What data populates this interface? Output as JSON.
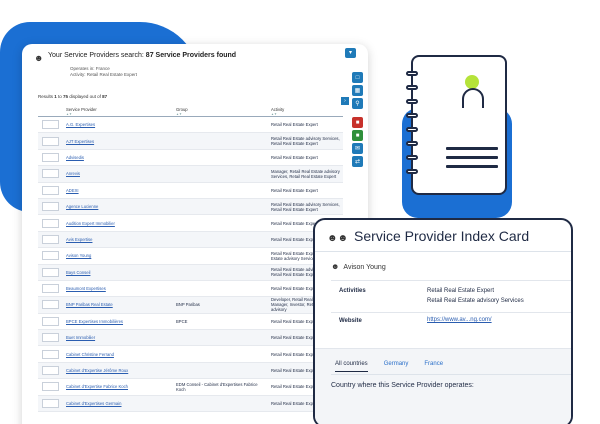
{
  "list_window": {
    "title_prefix": "Your Service Providers search: ",
    "title_bold": "87 Service Providers found",
    "filters": [
      "Operates in: France",
      "Activity: Retail Real Estate Expert"
    ],
    "results_prefix": "Results ",
    "results_from": "1",
    "results_mid": " to ",
    "results_to": "75",
    "results_suffix": " displayed out of ",
    "results_total": "87",
    "columns": {
      "provider": "Service Provider",
      "group": "Group",
      "activity": "Activity"
    },
    "rows": [
      {
        "name": "A.G. Expertises",
        "group": "",
        "activity": "Retail Real Estate Expert"
      },
      {
        "name": "AJT Expertises",
        "group": "",
        "activity": "Retail Real Estate advisory Services, Retail Real Estate Expert"
      },
      {
        "name": "Advisedis",
        "group": "",
        "activity": "Retail Real Estate Expert"
      },
      {
        "name": "Anrevis",
        "group": "",
        "activity": "Manager, Retail Real Estate advisory Services, Retail Real Estate Expert"
      },
      {
        "name": "ADEXI",
        "group": "",
        "activity": "Retail Real Estate Expert"
      },
      {
        "name": "Agence Lucienne",
        "group": "",
        "activity": "Retail Real Estate advisory Services, Retail Real Estate Expert"
      },
      {
        "name": "Audition Expert Immobilier",
        "group": "",
        "activity": "Retail Real Estate Expert"
      },
      {
        "name": "Avis Expertise",
        "group": "",
        "activity": "Retail Real Estate Expert"
      },
      {
        "name": "Avison Young",
        "group": "",
        "activity": "Retail Real Estate Expert, Retail Real Estate advisory Services"
      },
      {
        "name": "Bays Conseil",
        "group": "",
        "activity": "Retail Real Estate advisory Services, Retail Real Estate Expert"
      },
      {
        "name": "Beaumont Expertises",
        "group": "",
        "activity": "Retail Real Estate Expert"
      },
      {
        "name": "BNP Paribas Real Estate",
        "group": "BNP Paribas",
        "activity": "Developer, Retail Real Estate Expert, Manager, Investor, Retail Real Estate advisory"
      },
      {
        "name": "BPCE Expertises Immobilières",
        "group": "BPCE",
        "activity": "Retail Real Estate Expert"
      },
      {
        "name": "Buet Immobilier",
        "group": "",
        "activity": "Retail Real Estate Expert"
      },
      {
        "name": "Cabinet Christine Ferrand",
        "group": "",
        "activity": "Retail Real Estate Expert"
      },
      {
        "name": "Cabinet d'Expertise Jérôme Roux",
        "group": "",
        "activity": "Retail Real Estate Expert"
      },
      {
        "name": "Cabinet d'Expertise Fabrice Koch",
        "group": "EDM Conseil - Cabinet d'Expertises Fabrice Koch",
        "activity": "Retail Real Estate Expert"
      },
      {
        "name": "Cabinet d'Expertises Germain",
        "group": "",
        "activity": "Retail Real Estate Expert"
      }
    ]
  },
  "card": {
    "title": "Service Provider Index Card",
    "provider_name": "Avison Young",
    "activities_label": "Activities",
    "activities": [
      "Retail Real Estate Expert",
      "Retail Real Estate advisory Services"
    ],
    "website_label": "Website",
    "website": "https://www.av...ng.com/",
    "tabs": [
      "All countries",
      "Germany",
      "France"
    ],
    "country_note": "Country where this Service Provider operates:"
  },
  "colors": {
    "accent_blue": "#1b6fd3",
    "navy": "#1f2a44",
    "lime": "#b5e33a",
    "link": "#2a5db0"
  }
}
